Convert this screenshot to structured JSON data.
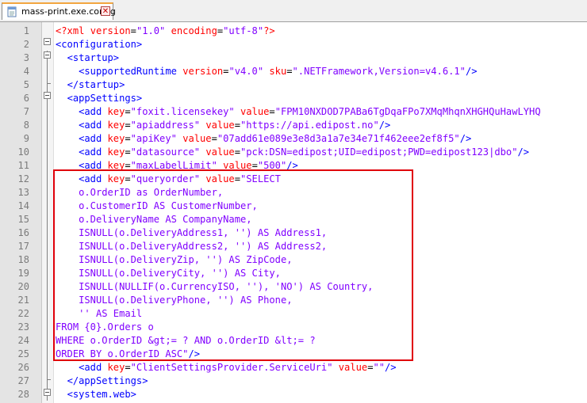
{
  "tab": {
    "title": "mass-print.exe.config",
    "save_icon": "notepad-file-icon",
    "close_icon": "close-icon",
    "close_glyph": "✕"
  },
  "colors": {
    "tag": "#0000ff",
    "attribute_name": "#ff0000",
    "attribute_value": "#8000ff",
    "highlight_box": "#e0000b"
  },
  "editor": {
    "line_numbers": [
      "1",
      "2",
      "3",
      "4",
      "5",
      "6",
      "7",
      "8",
      "9",
      "10",
      "11",
      "12",
      "13",
      "14",
      "15",
      "16",
      "17",
      "18",
      "19",
      "20",
      "21",
      "22",
      "23",
      "24",
      "25",
      "26",
      "27",
      "28"
    ],
    "lines": [
      [
        {
          "c": "pi",
          "t": "<?xml "
        },
        {
          "c": "an",
          "t": "version"
        },
        {
          "c": "",
          "t": "="
        },
        {
          "c": "av",
          "t": "\"1.0\""
        },
        {
          "c": "",
          "t": " "
        },
        {
          "c": "an",
          "t": "encoding"
        },
        {
          "c": "",
          "t": "="
        },
        {
          "c": "av",
          "t": "\"utf-8\""
        },
        {
          "c": "pi",
          "t": "?>"
        }
      ],
      [
        {
          "c": "t",
          "t": "<configuration>"
        }
      ],
      [
        {
          "c": "",
          "t": "  "
        },
        {
          "c": "t",
          "t": "<startup>"
        }
      ],
      [
        {
          "c": "",
          "t": "    "
        },
        {
          "c": "t",
          "t": "<supportedRuntime "
        },
        {
          "c": "an",
          "t": "version"
        },
        {
          "c": "",
          "t": "="
        },
        {
          "c": "av",
          "t": "\"v4.0\""
        },
        {
          "c": "",
          "t": " "
        },
        {
          "c": "an",
          "t": "sku"
        },
        {
          "c": "",
          "t": "="
        },
        {
          "c": "av",
          "t": "\".NETFramework,Version=v4.6.1\""
        },
        {
          "c": "t",
          "t": "/>"
        }
      ],
      [
        {
          "c": "",
          "t": "  "
        },
        {
          "c": "t",
          "t": "</startup>"
        }
      ],
      [
        {
          "c": "",
          "t": "  "
        },
        {
          "c": "t",
          "t": "<appSettings>"
        }
      ],
      [
        {
          "c": "",
          "t": "    "
        },
        {
          "c": "t",
          "t": "<add "
        },
        {
          "c": "an",
          "t": "key"
        },
        {
          "c": "",
          "t": "="
        },
        {
          "c": "av",
          "t": "\"foxit.licensekey\""
        },
        {
          "c": "",
          "t": " "
        },
        {
          "c": "an",
          "t": "value"
        },
        {
          "c": "",
          "t": "="
        },
        {
          "c": "av",
          "t": "\"FPM10NXDOD7PABa6TgDqaFPo7XMqMhqnXHGHQuHawLYHQ"
        }
      ],
      [
        {
          "c": "",
          "t": "    "
        },
        {
          "c": "t",
          "t": "<add "
        },
        {
          "c": "an",
          "t": "key"
        },
        {
          "c": "",
          "t": "="
        },
        {
          "c": "av",
          "t": "\"apiaddress\""
        },
        {
          "c": "",
          "t": " "
        },
        {
          "c": "an",
          "t": "value"
        },
        {
          "c": "",
          "t": "="
        },
        {
          "c": "av",
          "t": "\"https://api.edipost.no\""
        },
        {
          "c": "t",
          "t": "/>"
        }
      ],
      [
        {
          "c": "",
          "t": "    "
        },
        {
          "c": "t",
          "t": "<add "
        },
        {
          "c": "an",
          "t": "key"
        },
        {
          "c": "",
          "t": "="
        },
        {
          "c": "av",
          "t": "\"apiKey\""
        },
        {
          "c": "",
          "t": " "
        },
        {
          "c": "an",
          "t": "value"
        },
        {
          "c": "",
          "t": "="
        },
        {
          "c": "av",
          "t": "\"07add61e089e3e8d3a1a7e34e71f462eee2ef8f5\""
        },
        {
          "c": "t",
          "t": "/>"
        }
      ],
      [
        {
          "c": "",
          "t": "    "
        },
        {
          "c": "t",
          "t": "<add "
        },
        {
          "c": "an",
          "t": "key"
        },
        {
          "c": "",
          "t": "="
        },
        {
          "c": "av",
          "t": "\"datasource\""
        },
        {
          "c": "",
          "t": " "
        },
        {
          "c": "an",
          "t": "value"
        },
        {
          "c": "",
          "t": "="
        },
        {
          "c": "av",
          "t": "\"pck:DSN=edipost;UID=edipost;PWD=edipost123|dbo\""
        },
        {
          "c": "t",
          "t": "/>"
        }
      ],
      [
        {
          "c": "",
          "t": "    "
        },
        {
          "c": "t",
          "t": "<add "
        },
        {
          "c": "an",
          "t": "key"
        },
        {
          "c": "",
          "t": "="
        },
        {
          "c": "av",
          "t": "\"maxLabelLimit\""
        },
        {
          "c": "",
          "t": " "
        },
        {
          "c": "an",
          "t": "value"
        },
        {
          "c": "",
          "t": "="
        },
        {
          "c": "av",
          "t": "\"500\""
        },
        {
          "c": "t",
          "t": "/>"
        }
      ],
      [
        {
          "c": "",
          "t": "    "
        },
        {
          "c": "t",
          "t": "<add "
        },
        {
          "c": "an",
          "t": "key"
        },
        {
          "c": "",
          "t": "="
        },
        {
          "c": "av",
          "t": "\"queryorder\""
        },
        {
          "c": "",
          "t": " "
        },
        {
          "c": "an",
          "t": "value"
        },
        {
          "c": "",
          "t": "="
        },
        {
          "c": "av",
          "t": "\"SELECT"
        }
      ],
      [
        {
          "c": "av",
          "t": "    o.OrderID as OrderNumber,"
        }
      ],
      [
        {
          "c": "av",
          "t": "    o.CustomerID AS CustomerNumber,"
        }
      ],
      [
        {
          "c": "av",
          "t": "    o.DeliveryName AS CompanyName,"
        }
      ],
      [
        {
          "c": "av",
          "t": "    ISNULL(o.DeliveryAddress1, '') AS Address1,"
        }
      ],
      [
        {
          "c": "av",
          "t": "    ISNULL(o.DeliveryAddress2, '') AS Address2,"
        }
      ],
      [
        {
          "c": "av",
          "t": "    ISNULL(o.DeliveryZip, '') AS ZipCode,"
        }
      ],
      [
        {
          "c": "av",
          "t": "    ISNULL(o.DeliveryCity, '') AS City,"
        }
      ],
      [
        {
          "c": "av",
          "t": "    ISNULL(NULLIF(o.CurrencyISO, ''), 'NO') AS Country,"
        }
      ],
      [
        {
          "c": "av",
          "t": "    ISNULL(o.DeliveryPhone, '') AS Phone,"
        }
      ],
      [
        {
          "c": "av",
          "t": "    '' AS Email"
        }
      ],
      [
        {
          "c": "av",
          "t": "FROM {0}.Orders o"
        }
      ],
      [
        {
          "c": "av",
          "t": "WHERE o.OrderID &gt;= ? AND o.OrderID &lt;= ?"
        }
      ],
      [
        {
          "c": "av",
          "t": "ORDER BY o.OrderID ASC\""
        },
        {
          "c": "t",
          "t": "/>"
        }
      ],
      [
        {
          "c": "",
          "t": "    "
        },
        {
          "c": "t",
          "t": "<add "
        },
        {
          "c": "an",
          "t": "key"
        },
        {
          "c": "",
          "t": "="
        },
        {
          "c": "av",
          "t": "\"ClientSettingsProvider.ServiceUri\""
        },
        {
          "c": "",
          "t": " "
        },
        {
          "c": "an",
          "t": "value"
        },
        {
          "c": "",
          "t": "="
        },
        {
          "c": "av",
          "t": "\"\""
        },
        {
          "c": "t",
          "t": "/>"
        }
      ],
      [
        {
          "c": "",
          "t": "  "
        },
        {
          "c": "t",
          "t": "</appSettings>"
        }
      ],
      [
        {
          "c": "",
          "t": "  "
        },
        {
          "c": "t",
          "t": "<system.web>"
        }
      ]
    ]
  }
}
